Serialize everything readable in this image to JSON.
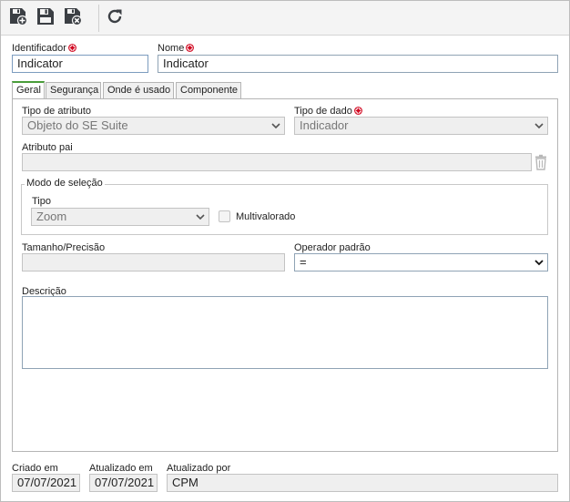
{
  "toolbar": {
    "save_new_icon": "save-and-new-icon",
    "save_icon": "save-icon",
    "save_close_icon": "save-and-close-icon",
    "refresh_icon": "refresh-icon"
  },
  "header": {
    "identifier_label": "Identificador",
    "identifier_value": "Indicator",
    "name_label": "Nome",
    "name_value": "Indicator"
  },
  "tabs": [
    {
      "label": "Geral",
      "active": true
    },
    {
      "label": "Segurança",
      "active": false
    },
    {
      "label": "Onde é usado",
      "active": false
    },
    {
      "label": "Componente",
      "active": false
    }
  ],
  "general": {
    "attribute_type_label": "Tipo de atributo",
    "attribute_type_value": "Objeto do SE Suite",
    "data_type_label": "Tipo de dado",
    "data_type_value": "Indicador",
    "parent_attribute_label": "Atributo pai",
    "parent_attribute_value": "",
    "selection_mode_legend": "Modo de seleção",
    "selection_type_label": "Tipo",
    "selection_type_value": "Zoom",
    "multivalued_label": "Multivalorado",
    "multivalued_checked": false,
    "size_label": "Tamanho/Precisão",
    "size_value": "",
    "default_operator_label": "Operador padrão",
    "default_operator_value": "=",
    "description_label": "Descrição",
    "description_value": ""
  },
  "footer": {
    "created_label": "Criado em",
    "created_value": "07/07/2021",
    "updated_label": "Atualizado em",
    "updated_value": "07/07/2021",
    "updated_by_label": "Atualizado por",
    "updated_by_value": "CPM"
  },
  "colors": {
    "required_marker": "#d0021b",
    "active_tab_accent": "#4a9d3a",
    "toolbar_icon": "#3b3f44"
  }
}
